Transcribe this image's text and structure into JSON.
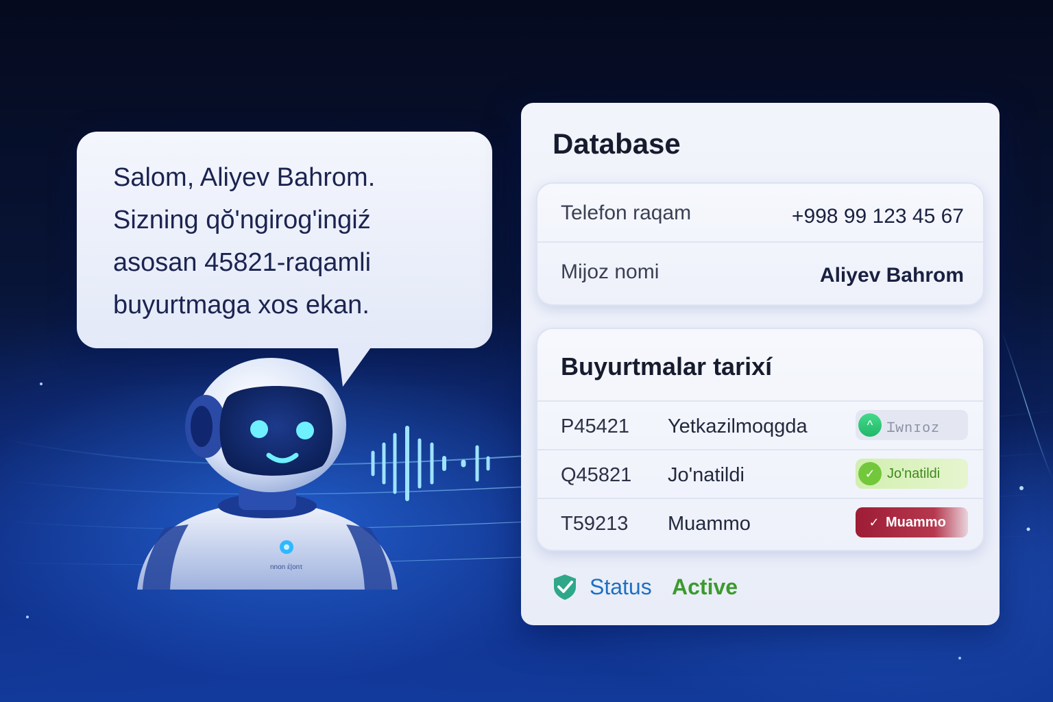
{
  "bubble": {
    "lines": [
      "Salom, Aliyev Bahrom.",
      "Sizning qŏ'ngirog'ingiź",
      "asosan 45821-raqamli",
      "buyurtmaga xos ekan."
    ]
  },
  "robot": {
    "chest_label": "nnon ἐ|onτ"
  },
  "database": {
    "title": "Database",
    "info": [
      {
        "label": "Telefon raqam",
        "value": "+998 99 123 45 67"
      },
      {
        "label": "Mijoz nomi",
        "value": "Aliyev Bahrom"
      }
    ],
    "orders": {
      "title": "Buyurtmalar tarixí",
      "rows": [
        {
          "id": "P45421",
          "status": "Yetkazilmoqgda",
          "badge": "Ɪwnɪoz",
          "badge_icon": "chevron-up-icon",
          "badge_color": "#21b86a"
        },
        {
          "id": "Q45821",
          "status": "Jo'natildi",
          "badge": "Jo'natildi",
          "badge_icon": "check-icon",
          "badge_color": "#72c83a"
        },
        {
          "id": "T59213",
          "status": "Muammo",
          "badge": "Muammo",
          "badge_icon": "check-icon",
          "badge_color": "#9e1c36"
        }
      ]
    },
    "status": {
      "label": "Status",
      "value": "Active",
      "value_color": "#3c9a2e"
    }
  }
}
